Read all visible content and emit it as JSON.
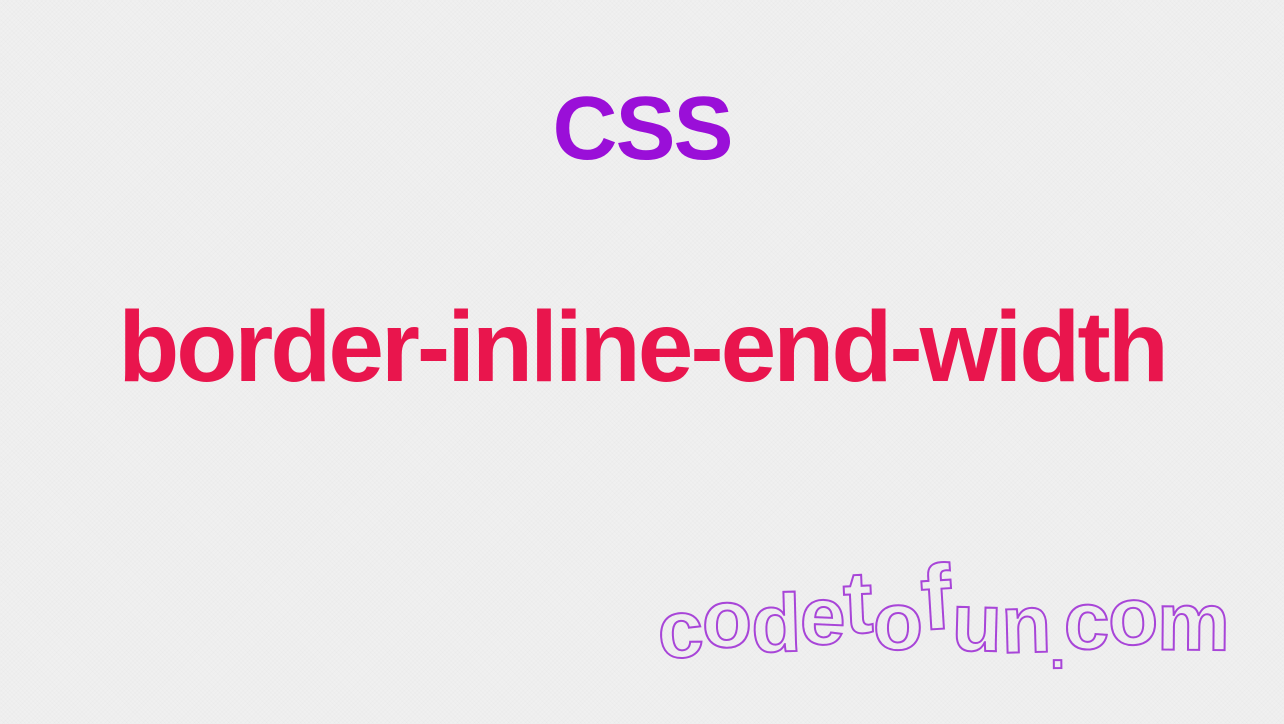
{
  "heading": "CSS",
  "property": "border-inline-end-width",
  "brand": "codetofun.com",
  "colors": {
    "heading": "#9a0fd8",
    "property": "#e9154d",
    "brand_stroke": "#a845d8",
    "background": "#f0f0f0"
  }
}
